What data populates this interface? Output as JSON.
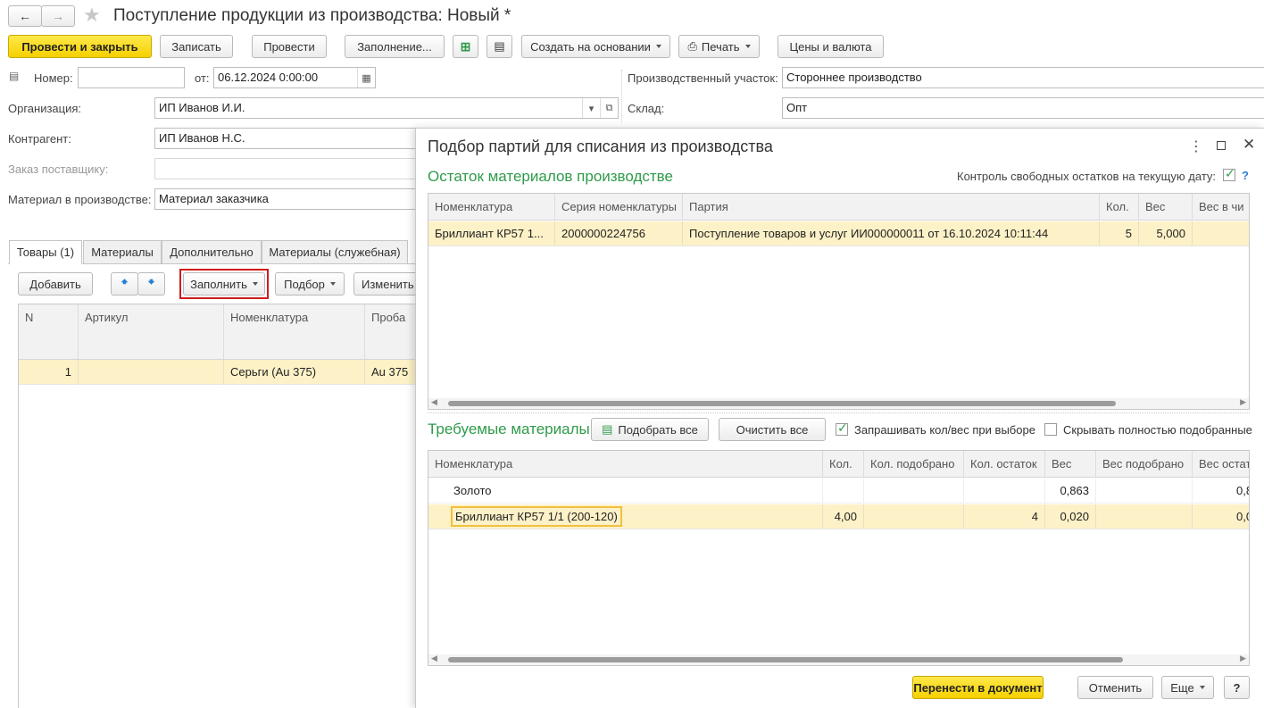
{
  "window": {
    "title": "Поступление продукции из производства: Новый *"
  },
  "toolbar": {
    "post_close": "Провести и закрыть",
    "save": "Записать",
    "post": "Провести",
    "fill": "Заполнение...",
    "create_based": "Создать на основании",
    "print": "Печать",
    "prices": "Цены и валюта"
  },
  "form": {
    "number_label": "Номер:",
    "number_value": "",
    "date_label": "от:",
    "date_value": "06.12.2024  0:00:00",
    "org_label": "Организация:",
    "org_value": "ИП Иванов И.И.",
    "contractor_label": "Контрагент:",
    "contractor_value": "ИП Иванов Н.С.",
    "supplier_order_label": "Заказ поставщику:",
    "material_label": "Материал в производстве:",
    "material_value": "Материал заказчика",
    "site_label": "Производственный участок:",
    "site_value": "Стороннее производство",
    "warehouse_label": "Склад:",
    "warehouse_value": "Опт"
  },
  "tabs": [
    "Товары (1)",
    "Материалы",
    "Дополнительно",
    "Материалы (служебная)"
  ],
  "goods_toolbar": {
    "add": "Добавить",
    "fill": "Заполнить",
    "pick": "Подбор",
    "change": "Изменить"
  },
  "goods_table": {
    "headers": [
      "N",
      "Артикул",
      "Номенклатура",
      "Проба"
    ],
    "rows": [
      {
        "n": "1",
        "article": "",
        "nomenclature": "Серьги (Au 375)",
        "probe": "Au 375"
      }
    ]
  },
  "dialog": {
    "title": "Подбор партий для списания из производства",
    "remains_title": "Остаток материалов  производстве",
    "control_label": "Контроль свободных остатков на текущую дату:",
    "control_checked": true,
    "help": "?",
    "remains_table": {
      "headers": [
        "Номенклатура",
        "Серия номенклатуры",
        "Партия",
        "Кол.",
        "Вес",
        "Вес в чи"
      ],
      "rows": [
        {
          "nomenclature": "Бриллиант КР57 1...",
          "series": "2000000224756",
          "batch": "Поступление товаров и услуг ИИ000000011 от 16.10.2024 10:11:44",
          "qty": "5",
          "weight": "5,000",
          "weight_in": ""
        }
      ]
    },
    "required_title": "Требуемые материалы",
    "pick_all": "Подобрать все",
    "clear_all": "Очистить все",
    "ask_qty_label": "Запрашивать кол/вес при выборе",
    "ask_qty_checked": true,
    "hide_picked_label": "Скрывать полностью подобранные",
    "hide_picked_checked": false,
    "required_table": {
      "headers": [
        "Номенклатура",
        "Кол.",
        "Кол. подобрано",
        "Кол. остаток",
        "Вес",
        "Вес подобрано",
        "Вес остат"
      ],
      "rows": [
        {
          "nomenclature": "Золото",
          "qty": "",
          "qty_picked": "",
          "qty_left": "",
          "weight": "0,863",
          "weight_picked": "",
          "weight_left": "0,8"
        },
        {
          "nomenclature": "Бриллиант КР57 1/1 (200-120)",
          "qty": "4,00",
          "qty_picked": "",
          "qty_left": "4",
          "weight": "0,020",
          "weight_picked": "",
          "weight_left": "0,0"
        }
      ]
    },
    "transfer": "Перенести в документ",
    "cancel": "Отменить",
    "more": "Еще",
    "help_btn": "?"
  },
  "colors": {
    "primary_button": "#f5d000",
    "selected_row": "#fdf1c7",
    "section_title": "#2f9b4a",
    "highlight_border": "#d01c1c"
  }
}
